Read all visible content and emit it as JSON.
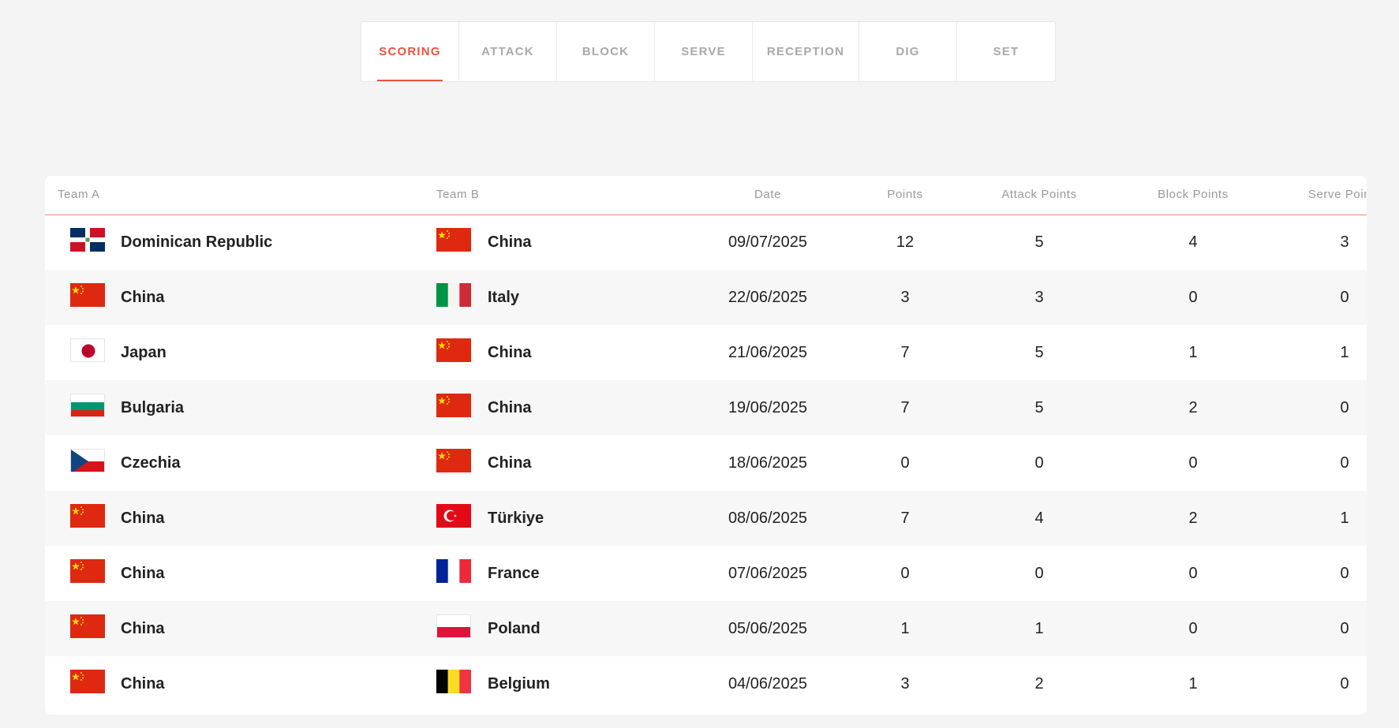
{
  "tabs": [
    {
      "label": "SCORING",
      "active": true
    },
    {
      "label": "ATTACK",
      "active": false
    },
    {
      "label": "BLOCK",
      "active": false
    },
    {
      "label": "SERVE",
      "active": false
    },
    {
      "label": "RECEPTION",
      "active": false
    },
    {
      "label": "DIG",
      "active": false
    },
    {
      "label": "SET",
      "active": false
    }
  ],
  "table": {
    "headers": {
      "team_a": "Team A",
      "team_b": "Team B",
      "date": "Date",
      "points": "Points",
      "attack_points": "Attack Points",
      "block_points": "Block Points",
      "serve_points": "Serve Points"
    },
    "rows": [
      {
        "team_a": "Dominican Republic",
        "flag_a": "dominican-republic-flag-icon",
        "team_b": "China",
        "flag_b": "china-flag-icon",
        "date": "09/07/2025",
        "points": "12",
        "attack_points": "5",
        "block_points": "4",
        "serve_points": "3"
      },
      {
        "team_a": "China",
        "flag_a": "china-flag-icon",
        "team_b": "Italy",
        "flag_b": "italy-flag-icon",
        "date": "22/06/2025",
        "points": "3",
        "attack_points": "3",
        "block_points": "0",
        "serve_points": "0"
      },
      {
        "team_a": "Japan",
        "flag_a": "japan-flag-icon",
        "team_b": "China",
        "flag_b": "china-flag-icon",
        "date": "21/06/2025",
        "points": "7",
        "attack_points": "5",
        "block_points": "1",
        "serve_points": "1"
      },
      {
        "team_a": "Bulgaria",
        "flag_a": "bulgaria-flag-icon",
        "team_b": "China",
        "flag_b": "china-flag-icon",
        "date": "19/06/2025",
        "points": "7",
        "attack_points": "5",
        "block_points": "2",
        "serve_points": "0"
      },
      {
        "team_a": "Czechia",
        "flag_a": "czechia-flag-icon",
        "team_b": "China",
        "flag_b": "china-flag-icon",
        "date": "18/06/2025",
        "points": "0",
        "attack_points": "0",
        "block_points": "0",
        "serve_points": "0"
      },
      {
        "team_a": "China",
        "flag_a": "china-flag-icon",
        "team_b": "Türkiye",
        "flag_b": "turkiye-flag-icon",
        "date": "08/06/2025",
        "points": "7",
        "attack_points": "4",
        "block_points": "2",
        "serve_points": "1"
      },
      {
        "team_a": "China",
        "flag_a": "china-flag-icon",
        "team_b": "France",
        "flag_b": "france-flag-icon",
        "date": "07/06/2025",
        "points": "0",
        "attack_points": "0",
        "block_points": "0",
        "serve_points": "0"
      },
      {
        "team_a": "China",
        "flag_a": "china-flag-icon",
        "team_b": "Poland",
        "flag_b": "poland-flag-icon",
        "date": "05/06/2025",
        "points": "1",
        "attack_points": "1",
        "block_points": "0",
        "serve_points": "0"
      },
      {
        "team_a": "China",
        "flag_a": "china-flag-icon",
        "team_b": "Belgium",
        "flag_b": "belgium-flag-icon",
        "date": "04/06/2025",
        "points": "3",
        "attack_points": "2",
        "block_points": "1",
        "serve_points": "0"
      }
    ]
  },
  "colors": {
    "accent": "#e8533f",
    "page_bg": "#f4f4f4",
    "card_bg": "#ffffff",
    "alt_row_bg": "#f7f7f7"
  }
}
